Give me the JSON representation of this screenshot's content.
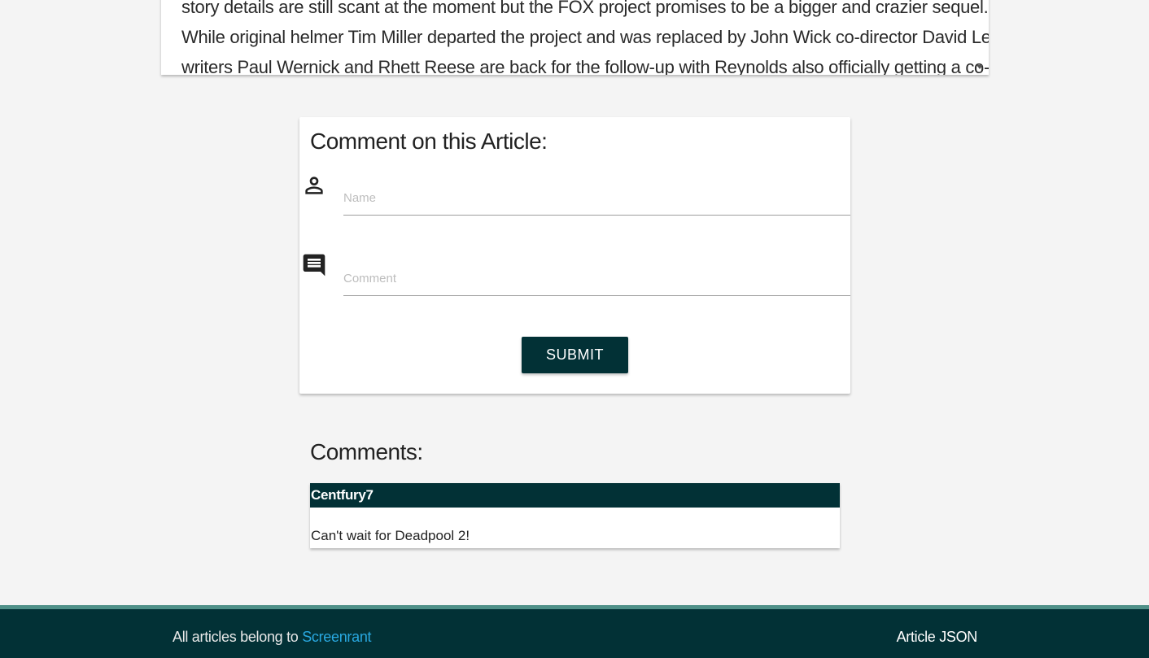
{
  "article": {
    "lines": [
      "story details are still scant at the moment but the FOX project promises to be a bigger and crazier sequel.",
      "While original helmer Tim Miller departed the project and was replaced by John Wick co-director David Leitch,",
      "writers Paul Wernick and Rhett Reese are back for the follow-up with Reynolds also officially getting a co-"
    ]
  },
  "comment_form": {
    "title": "Comment on this Article:",
    "name_placeholder": "Name",
    "comment_placeholder": "Comment",
    "submit_label": "SUBMIT"
  },
  "comments": {
    "title": "Comments:",
    "items": [
      {
        "author": "Centfury7",
        "text": "Can't wait for Deadpool 2!"
      }
    ]
  },
  "footer": {
    "credit_prefix": "All articles belong to ",
    "credit_link": "Screenrant",
    "json_link": "Article JSON"
  },
  "colors": {
    "primary_dark": "#023136",
    "footer_accent": "#4f9088",
    "link": "#29a8e0"
  }
}
